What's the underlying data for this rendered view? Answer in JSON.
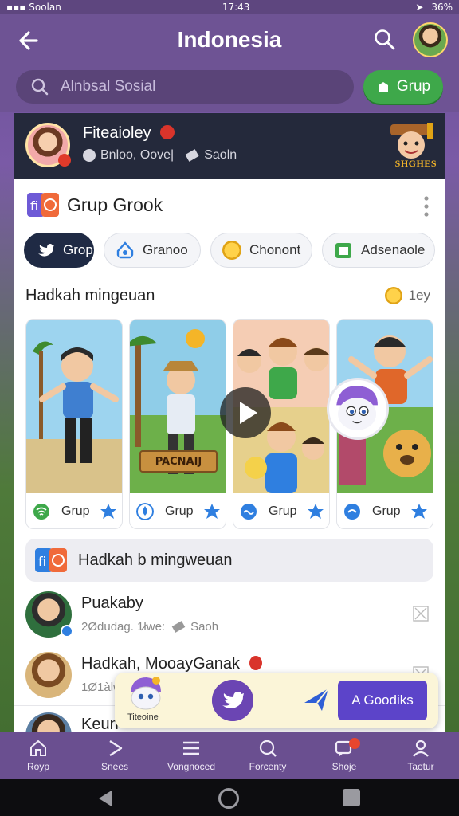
{
  "status_bar": {
    "left": "Soolan",
    "time": "17:43",
    "battery": "36%"
  },
  "header": {
    "title": "Indonesia"
  },
  "search": {
    "placeholder": "Alnbsal Sosial",
    "button_label": "Grup"
  },
  "profile": {
    "name": "Fiteaioley",
    "sub_left": "Bnloo, Oove|",
    "sub_right": "Saoln",
    "badge_text": "SHGHES"
  },
  "group": {
    "title": "Grup Grook"
  },
  "chips": [
    {
      "label": "Grop",
      "active": true,
      "icon": "twitter-bird-icon",
      "color": "#1da1f2"
    },
    {
      "label": "Granoo",
      "active": false,
      "icon": "house-icon",
      "color": "#2f7fe0"
    },
    {
      "label": "Chonont",
      "active": false,
      "icon": "coin-icon",
      "color": "#f4b528"
    },
    {
      "label": "Adsenaole",
      "active": false,
      "icon": "calendar-icon",
      "color": "#3ea84a"
    }
  ],
  "section": {
    "title": "Hadkah mingeuan",
    "side": "1ey"
  },
  "tiles": [
    {
      "label": "Grup",
      "icon": "wifi-icon",
      "icon_color": "#3ea84a"
    },
    {
      "label": "Grup",
      "icon": "drop-icon",
      "icon_color": "#2f7fe0",
      "sign": "PACNAIJ"
    },
    {
      "label": "Grup",
      "icon": "wave-icon",
      "icon_color": "#2f7fe0"
    },
    {
      "label": "Grup",
      "icon": "link-icon",
      "icon_color": "#2f7fe0"
    }
  ],
  "banner": {
    "text": "Hadkah b mingweuan"
  },
  "list": [
    {
      "title": "Puakaby",
      "sub_left": "2Ødudag. 1̷lwe:",
      "sub_right": "Saoh"
    },
    {
      "title": "Hadkah, MooayGanak",
      "sub_left": "1Ø1àlwíæ Þáëà",
      "sub_right": ""
    },
    {
      "title": "Keun",
      "sub_left": "",
      "sub_right": ""
    }
  ],
  "action_bar": {
    "mascot_label": "Titeoine",
    "cta_label": "A Goodiks"
  },
  "bottom_nav": [
    {
      "label": "Royp",
      "icon": "home-icon"
    },
    {
      "label": "Snees",
      "icon": "play-icon"
    },
    {
      "label": "Vongnoced",
      "icon": "menu-icon"
    },
    {
      "label": "Forcenty",
      "icon": "search-icon"
    },
    {
      "label": "Shoje",
      "icon": "chat-icon"
    },
    {
      "label": "Taotur",
      "icon": "person-icon"
    }
  ]
}
